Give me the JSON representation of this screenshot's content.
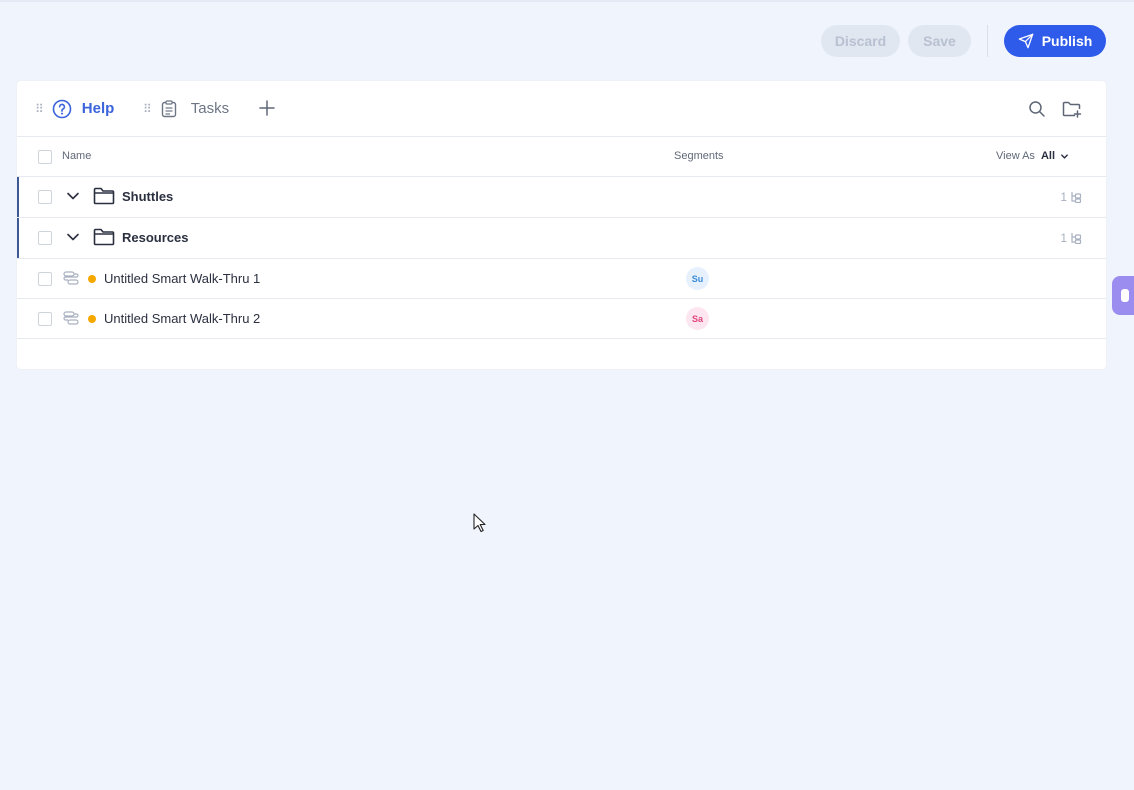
{
  "toolbar": {
    "discard_label": "Discard",
    "save_label": "Save",
    "publish_label": "Publish",
    "publish_icon": "send-icon"
  },
  "tabs": [
    {
      "label": "Help",
      "icon": "help-circle-icon",
      "active": true
    },
    {
      "label": "Tasks",
      "icon": "clipboard-icon",
      "active": false
    }
  ],
  "table": {
    "headers": {
      "name": "Name",
      "segments": "Segments",
      "view_as_label": "View As",
      "view_as_value": "All"
    },
    "folders": [
      {
        "name": "Shuttles",
        "count": "1"
      },
      {
        "name": "Resources",
        "count": "1"
      }
    ],
    "items": [
      {
        "name": "Untitled Smart Walk-Thru 1",
        "segment": "Su",
        "status_color": "#f5a900"
      },
      {
        "name": "Untitled Smart Walk-Thru 2",
        "segment": "Sa",
        "status_color": "#f5a900"
      }
    ]
  },
  "colors": {
    "accent": "#2f5bea",
    "active_tab": "#3a63dc",
    "background": "#f0f4fc",
    "side_tab": "#9b8df0"
  }
}
